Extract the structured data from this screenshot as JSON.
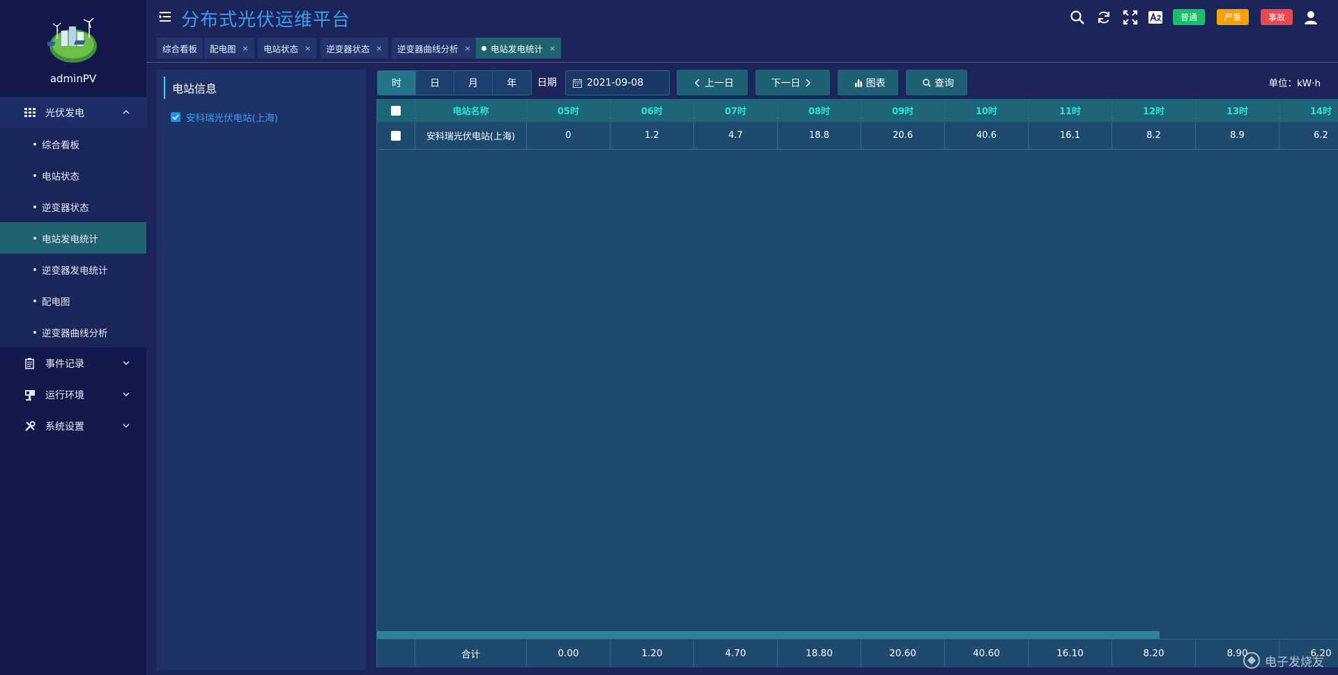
{
  "sidebar": {
    "username": "adminPV",
    "groups": [
      {
        "label": "光伏发电",
        "icon": "grid-icon",
        "expanded": true,
        "items": [
          {
            "label": "综合看板"
          },
          {
            "label": "电站状态"
          },
          {
            "label": "逆变器状态"
          },
          {
            "label": "电站发电统计",
            "active": true
          },
          {
            "label": "逆变器发电统计"
          },
          {
            "label": "配电图"
          },
          {
            "label": "逆变器曲线分析"
          }
        ]
      },
      {
        "label": "事件记录",
        "icon": "record-icon"
      },
      {
        "label": "运行环境",
        "icon": "monitor-icon"
      },
      {
        "label": "系统设置",
        "icon": "tools-icon"
      }
    ]
  },
  "header": {
    "title": "分布式光伏运维平台",
    "badges": {
      "normal": "普通",
      "serious": "严重",
      "accident": "事故"
    },
    "colors": {
      "normal": "#19be6b",
      "serious": "#f5a20a",
      "accident": "#e8494e",
      "title": "#3d9bf0"
    }
  },
  "tabs": [
    {
      "label": "综合看板",
      "closable": false
    },
    {
      "label": "配电图",
      "closable": true
    },
    {
      "label": "电站状态",
      "closable": true
    },
    {
      "label": "逆变器状态",
      "closable": true
    },
    {
      "label": "逆变器曲线分析",
      "closable": true
    },
    {
      "label": "电站发电统计",
      "closable": true,
      "active": true
    }
  ],
  "tab_close": "×",
  "panel": {
    "title": "电站信息",
    "station": "安科瑞光伏电站(上海)"
  },
  "toolbar": {
    "periods": [
      "时",
      "日",
      "月",
      "年"
    ],
    "active_period": "时",
    "date_label": "日期",
    "date_value": "2021-09-08",
    "prev_label": "上一日",
    "next_label": "下一日",
    "chart_label": "图表",
    "query_label": "查询",
    "unit": "单位：kW·h"
  },
  "table": {
    "name_header": "电站名称",
    "hour_headers": [
      "05时",
      "06时",
      "07时",
      "08时",
      "09时",
      "10时",
      "11时",
      "12时",
      "13时",
      "14时"
    ],
    "rows": [
      {
        "name": "安科瑞光伏电站(上海)",
        "values": [
          "0",
          "1.2",
          "4.7",
          "18.8",
          "20.6",
          "40.6",
          "16.1",
          "8.2",
          "8.9",
          "6.2"
        ]
      }
    ],
    "total_label": "合计",
    "totals": [
      "0.00",
      "1.20",
      "4.70",
      "18.80",
      "20.60",
      "40.60",
      "16.10",
      "8.20",
      "8.90",
      "6.20"
    ]
  },
  "watermark": "电子发烧友"
}
